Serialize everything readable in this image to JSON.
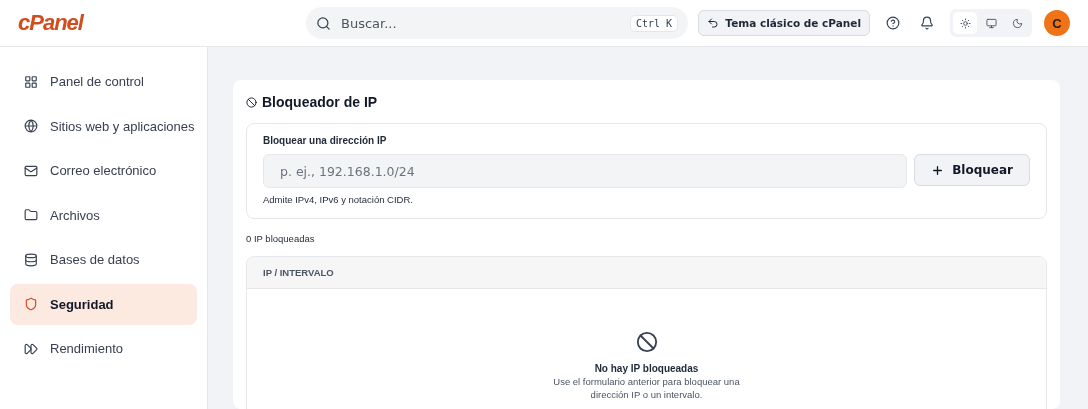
{
  "header": {
    "logo": "cPanel",
    "search": {
      "placeholder": "Buscar...",
      "shortcut": "Ctrl K"
    },
    "classic_button": "Tema clásico de cPanel",
    "theme_options": [
      {
        "kind": "light",
        "selected": true
      },
      {
        "kind": "system",
        "selected": false
      },
      {
        "kind": "dark",
        "selected": false
      }
    ],
    "avatar": "C"
  },
  "sidebar": {
    "items": [
      {
        "label": "Panel de control",
        "selected": false
      },
      {
        "label": "Sitios web y aplicaciones",
        "selected": false
      },
      {
        "label": "Correo electrónico",
        "selected": false
      },
      {
        "label": "Archivos",
        "selected": false
      },
      {
        "label": "Bases de datos",
        "selected": false
      },
      {
        "label": "Seguridad",
        "selected": true
      },
      {
        "label": "Rendimiento",
        "selected": false
      }
    ]
  },
  "page": {
    "title": "Bloqueador de IP",
    "form": {
      "label": "Bloquear una dirección IP",
      "placeholder": "p. ej., 192.168.1.0/24",
      "button": "Bloquear",
      "hint": "Admite IPv4, IPv6 y notación CIDR."
    },
    "count": "0 IP bloqueadas",
    "table": {
      "columns": [
        "IP / INTERVALO"
      ],
      "empty_title": "No hay IP bloqueadas",
      "empty_text": "Use el formulario anterior para bloquear una dirección IP o un intervalo."
    }
  }
}
